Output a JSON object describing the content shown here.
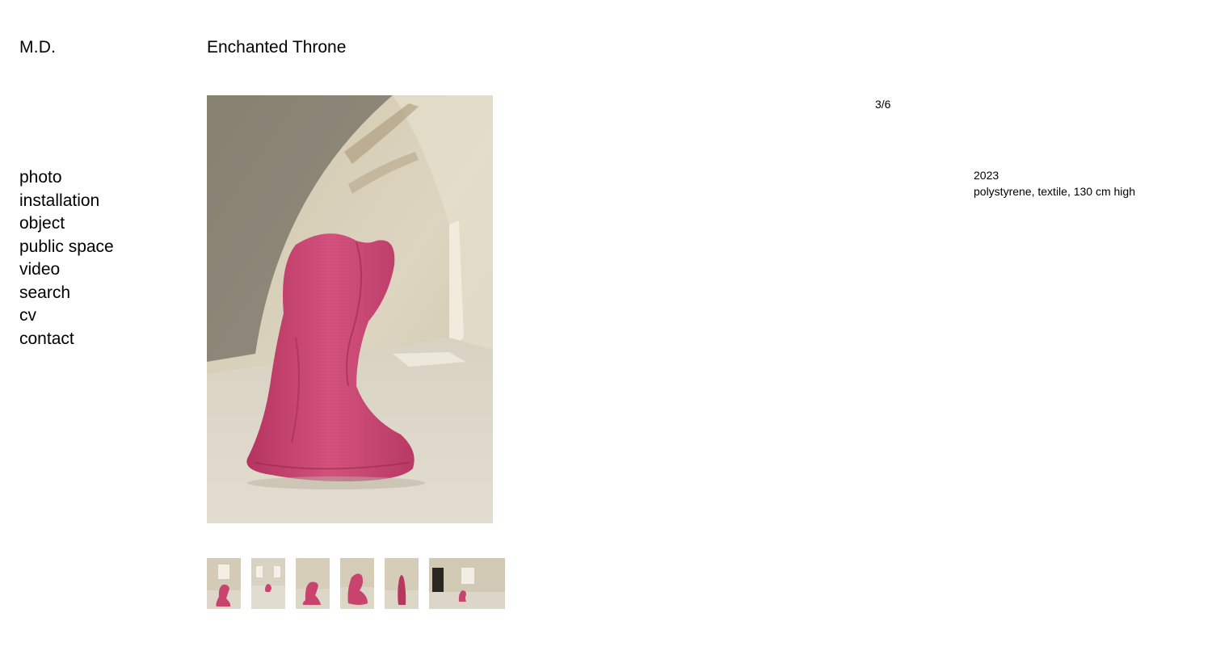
{
  "site": {
    "logo": "M.D."
  },
  "work": {
    "title": "Enchanted Throne",
    "counter": "3/6",
    "year": "2023",
    "materials": "polystyrene, textile, 130 cm high",
    "image_description": "pink fabric-covered sculpture in an old vaulted room"
  },
  "nav": {
    "items": [
      {
        "label": "photo"
      },
      {
        "label": "installation"
      },
      {
        "label": "object"
      },
      {
        "label": "public space"
      },
      {
        "label": "video"
      },
      {
        "label": "search"
      },
      {
        "label": "cv"
      },
      {
        "label": "contact"
      }
    ]
  },
  "thumbnails": [
    {
      "index": 1
    },
    {
      "index": 2
    },
    {
      "index": 3
    },
    {
      "index": 4
    },
    {
      "index": 5
    },
    {
      "index": 6
    }
  ],
  "colors": {
    "wall": "#d9d1bc",
    "floor": "#dcd6c8",
    "sculpture": "#c8436e",
    "sculpture_shade": "#a93359",
    "text": "#000000",
    "background": "#ffffff"
  }
}
